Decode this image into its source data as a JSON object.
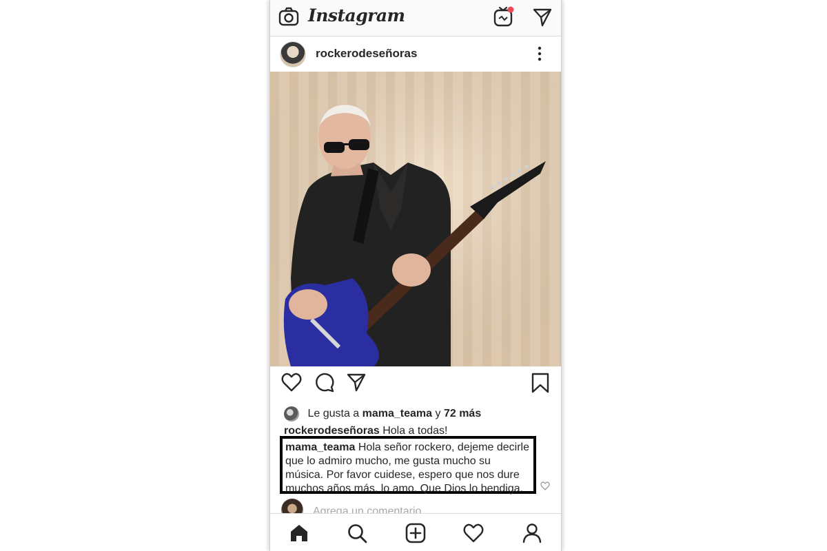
{
  "app": {
    "title": "Instagram"
  },
  "post": {
    "username": "rockerodeseñoras",
    "likes": {
      "prefix": "Le gusta a",
      "user": "mama_teama",
      "connector": "y",
      "others": "72 más"
    },
    "caption": {
      "user": "rockerodeseñoras",
      "text": "Hola a todas!"
    },
    "comment": {
      "user": "mama_teama",
      "text": "Hola señor rockero, dejeme decirle que lo admiro mucho, me gusta mucho su música. Por favor cuidese, espero que nos dure muchos años más, lo amo. Que Dios lo bendiga."
    },
    "add_comment_placeholder": "Agrega un comentario..."
  },
  "icons": {
    "topbar": [
      "camera-icon",
      "igtv-icon",
      "direct-message-icon"
    ],
    "post_actions": [
      "like-icon",
      "comment-icon",
      "share-icon",
      "bookmark-icon"
    ],
    "bottom_nav": [
      "home-icon",
      "search-icon",
      "new-post-icon",
      "activity-icon",
      "profile-icon"
    ]
  },
  "colors": {
    "notification_dot": "#ed4956",
    "text": "#262626",
    "placeholder": "#a8a8a8",
    "comment_box_border": "#000000"
  }
}
